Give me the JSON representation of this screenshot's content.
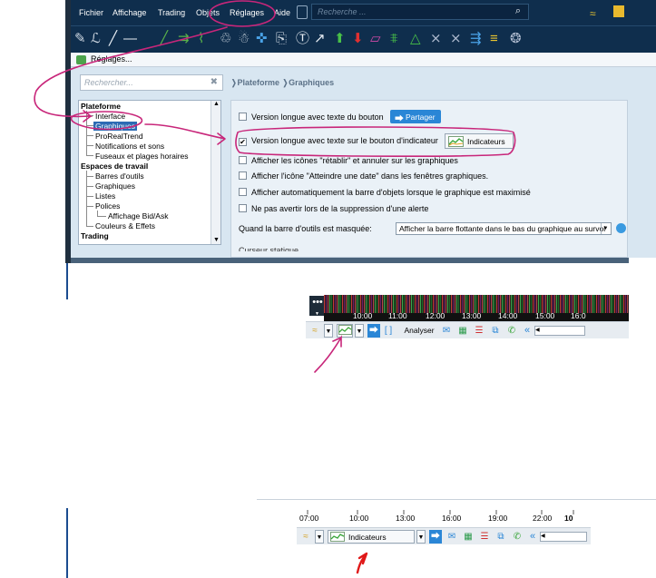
{
  "menu": {
    "items": [
      "Fichier",
      "Affichage",
      "Trading",
      "Objets",
      "Réglages",
      "Aide"
    ],
    "search_placeholder": "Recherche ..."
  },
  "window": {
    "title": "Réglages..."
  },
  "settings": {
    "search_placeholder": "Rechercher...",
    "breadcrumb": [
      "Plateforme",
      "Graphiques"
    ],
    "tree": {
      "plateforme": "Plateforme",
      "interface": "Interface",
      "graphiques": "Graphiques",
      "prorealtrend": "ProRealTrend",
      "notifications": "Notifications et sons",
      "fuseaux": "Fuseaux et plages horaires",
      "espaces": "Espaces de travail",
      "barres": "Barres d'outils",
      "graphiques2": "Graphiques",
      "listes": "Listes",
      "polices": "Polices",
      "bidask": "Affichage Bid/Ask",
      "couleurs": "Couleurs & Effets",
      "trading": "Trading"
    },
    "options": [
      {
        "label": "Version longue avec texte du bouton",
        "checked": false
      },
      {
        "label": "Version longue avec texte sur le bouton d'indicateur",
        "checked": true
      },
      {
        "label": "Afficher les icônes \"rétablir\" et annuler sur les graphiques",
        "checked": false
      },
      {
        "label": "Afficher l'icône \"Atteindre une date\" dans les fenêtres graphiques.",
        "checked": false
      },
      {
        "label": "Afficher automatiquement la barre d'objets lorsque le graphique est maximisé",
        "checked": false
      },
      {
        "label": "Ne pas avertir lors de la suppression d'une alerte",
        "checked": false
      }
    ],
    "share_label": "Partager",
    "indicators_label": "Indicateurs",
    "toolbar_hidden_label": "Quand la barre d'outils est masquée:",
    "toolbar_hidden_value": "Afficher la barre flottante dans le bas du graphique au survol",
    "cut_section": "Curseur statique"
  },
  "chart1": {
    "times": [
      "10:00",
      "11:00",
      "12:00",
      "13:00",
      "14:00",
      "15:00",
      "16:0"
    ],
    "analyse_label": "Analyser"
  },
  "chart2": {
    "times": [
      "07:00",
      "10:00",
      "13:00",
      "16:00",
      "19:00",
      "22:00",
      "10"
    ],
    "indicators_label": "Indicateurs"
  },
  "colors": {
    "annotation": "#c8267a",
    "arrow_red": "#e01818",
    "menubar": "#0f2e4d",
    "selected": "#2d6bb4",
    "share": "#2a86d6"
  }
}
